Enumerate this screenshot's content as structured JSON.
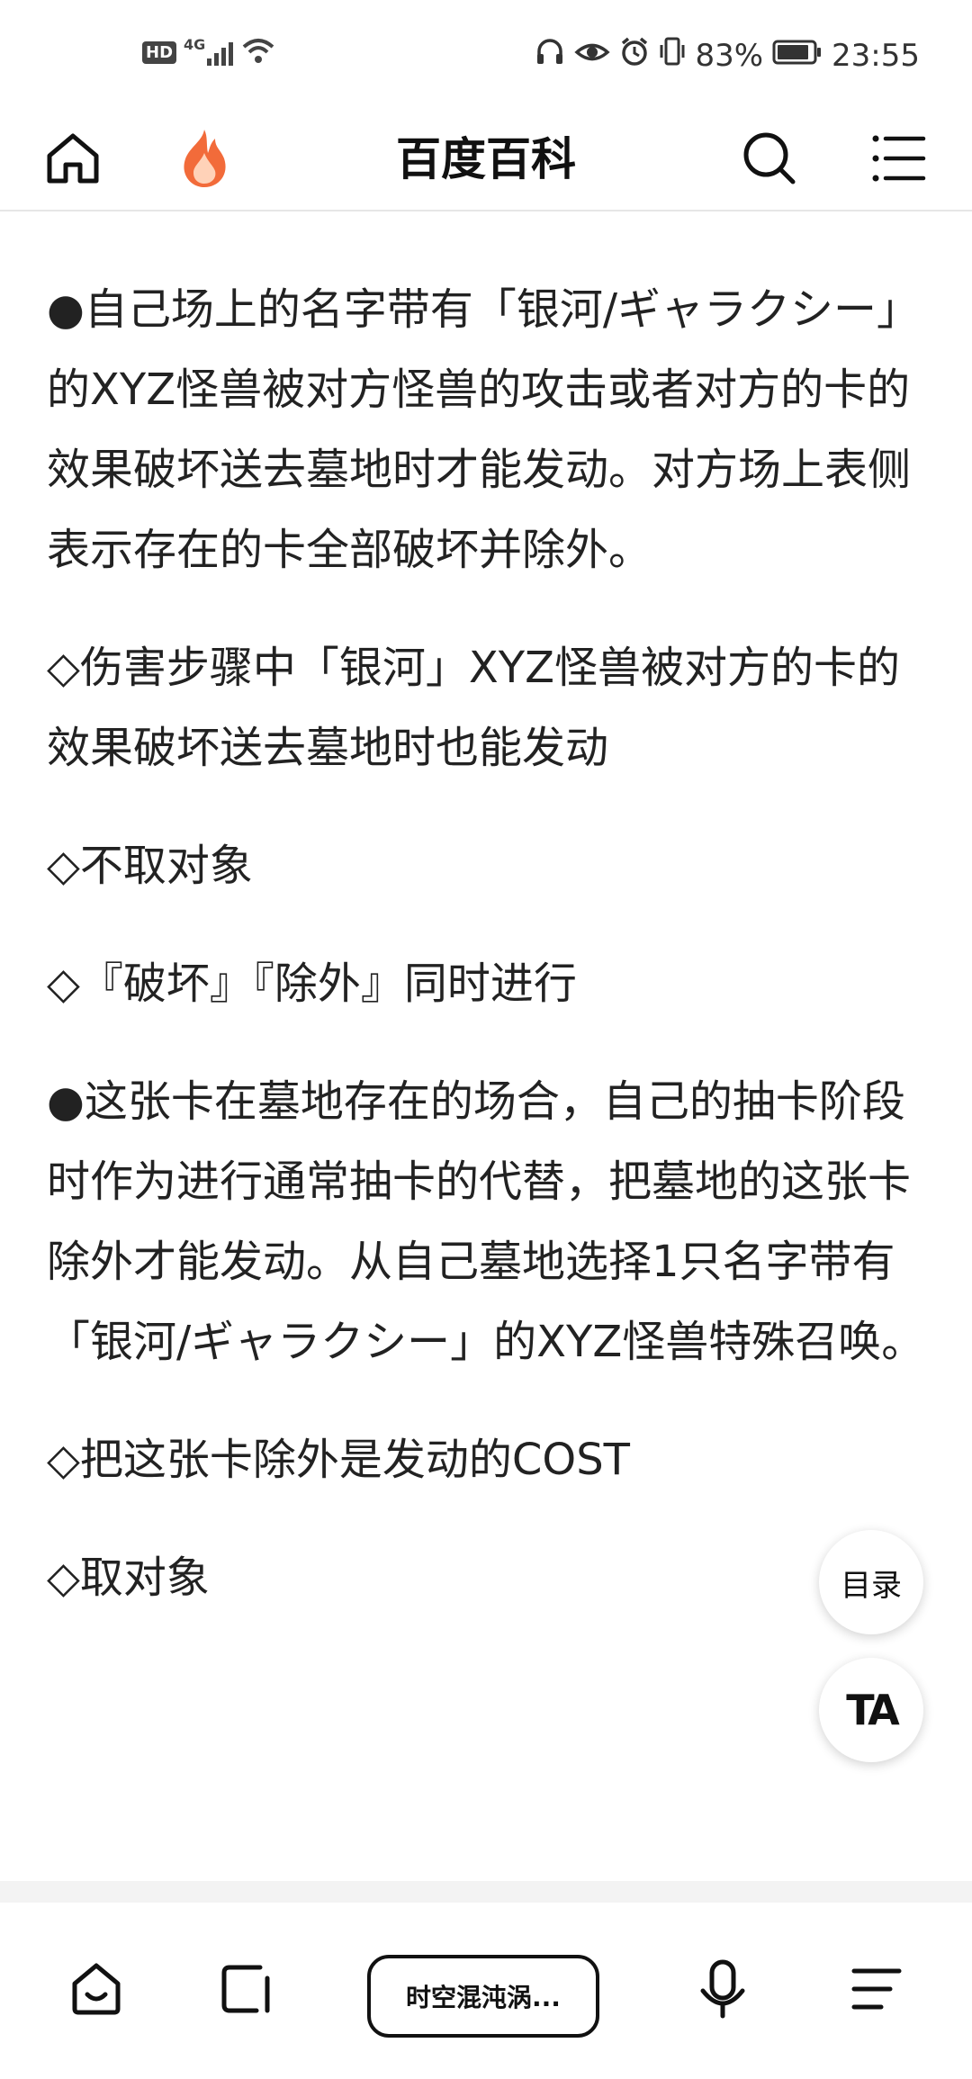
{
  "status_bar": {
    "hd": "HD",
    "network": "4G",
    "battery": "83%",
    "time": "23:55"
  },
  "header": {
    "title": "百度百科",
    "icons": [
      "home-icon",
      "flame-icon",
      "search-icon",
      "menu-icon"
    ]
  },
  "content": {
    "paragraphs": [
      "●自己场上的名字带有「银河/ギャラクシー」的XYZ怪兽被对方怪兽的攻击或者对方的卡的效果破坏送去墓地时才能发动。对方场上表侧表示存在的卡全部破坏并除外。",
      "◇伤害步骤中「银河」XYZ怪兽被对方的卡的效果破坏送去墓地时也能发动",
      "◇不取对象",
      "◇『破坏』『除外』同时进行",
      "●这张卡在墓地存在的场合，自己的抽卡阶段时作为进行通常抽卡的代替，把墓地的这张卡除外才能发动。从自己墓地选择1只名字带有「银河/ギャラクシー」的XYZ怪兽特殊召唤。",
      "◇把这张卡除外是发动的COST",
      "◇取对象"
    ]
  },
  "floating": {
    "toc_label": "目录",
    "ta_label": "TA"
  },
  "bottom_bar": {
    "center_label": "时空混沌涡...",
    "icons": [
      "home-face-icon",
      "tabs-icon",
      "microphone-icon",
      "list-icon"
    ]
  },
  "colors": {
    "flame_orange": "#F26B3A",
    "flame_light": "#FFD2B8",
    "text": "#222222"
  }
}
